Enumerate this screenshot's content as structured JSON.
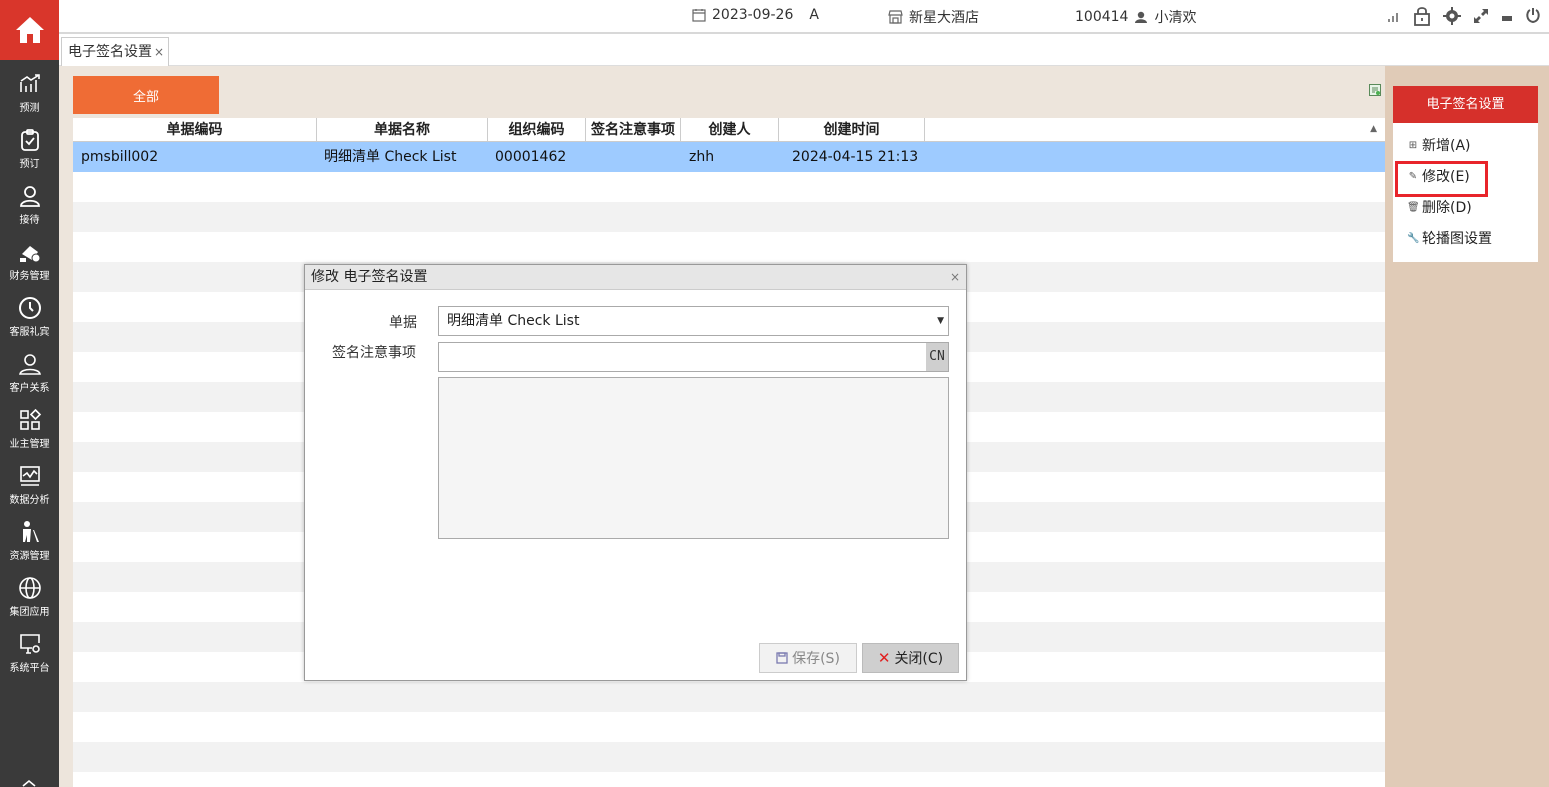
{
  "topbar": {
    "date": "2023-09-26",
    "shift": "A",
    "hotel": "新星大酒店",
    "user_id": "100414",
    "user_name": "小清欢"
  },
  "nav": {
    "items": [
      {
        "label": "预测",
        "icon": "trend-icon"
      },
      {
        "label": "预订",
        "icon": "clipboard-icon"
      },
      {
        "label": "接待",
        "icon": "person-icon"
      },
      {
        "label": "财务管理",
        "icon": "finance-icon"
      },
      {
        "label": "客服礼宾",
        "icon": "clock-icon"
      },
      {
        "label": "客户关系",
        "icon": "people-icon"
      },
      {
        "label": "业主管理",
        "icon": "grid-icon"
      },
      {
        "label": "数据分析",
        "icon": "chart-icon"
      },
      {
        "label": "资源管理",
        "icon": "cleaner-icon"
      },
      {
        "label": "集团应用",
        "icon": "globe-icon"
      },
      {
        "label": "系统平台",
        "icon": "monitor-gear-icon"
      }
    ]
  },
  "tabs": [
    {
      "label": "电子签名设置",
      "close": "×"
    }
  ],
  "filter": {
    "all_label": "全部"
  },
  "grid": {
    "columns": [
      "单据编码",
      "单据名称",
      "组织编码",
      "签名注意事项",
      "创建人",
      "创建时间"
    ],
    "rows": [
      [
        "pmsbill002",
        "明细清单  Check List",
        "00001462",
        "",
        "zhh",
        "2024-04-15 21:13"
      ]
    ]
  },
  "right_panel": {
    "title": "电子签名设置",
    "menu": [
      {
        "label": "新增(A)",
        "icon": "plus-square-icon"
      },
      {
        "label": "修改(E)",
        "icon": "edit-icon"
      },
      {
        "label": "删除(D)",
        "icon": "trash-icon"
      },
      {
        "label": "轮播图设置",
        "icon": "wrench-icon"
      }
    ]
  },
  "dialog": {
    "title": "修改 电子签名设置",
    "close": "×",
    "bill_label": "单据",
    "bill_value": "明细清单  Check List",
    "notes_label": "签名注意事项",
    "notes_value": "",
    "lang_button": "CN",
    "save_label": "保存(S)",
    "close_label": "关闭(C)"
  },
  "colors": {
    "accent_red": "#d6302b",
    "orange": "#ef6c35",
    "selected_row": "#9ecbff",
    "nav_bg": "#3a3a3a"
  }
}
